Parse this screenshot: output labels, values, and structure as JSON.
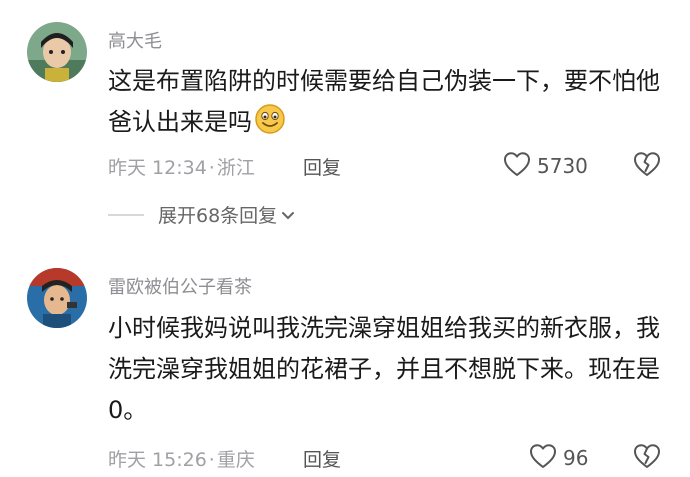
{
  "comments": [
    {
      "username": "高大毛",
      "text": "这是布置陷阱的时候需要给自己伪装一下，要不怕他爸认出来是吗",
      "emoji_icon": "grinning-face-emoji",
      "time": "昨天 12:34",
      "separator": "·",
      "location": "浙江",
      "reply_label": "回复",
      "like_count": "5730",
      "expand_label": "展开68条回复"
    },
    {
      "username": "雷欧被伯公子看茶",
      "text": "小时候我妈说叫我洗完澡穿姐姐给我买的新衣服，我洗完澡穿我姐姐的花裙子，并且不想脱下来。现在是0。",
      "time": "昨天 15:26",
      "separator": "·",
      "location": "重庆",
      "reply_label": "回复",
      "like_count": "96"
    }
  ],
  "icons": {
    "like": "heart-outline-icon",
    "dislike": "broken-heart-icon",
    "expand": "chevron-down-icon"
  },
  "colors": {
    "username": "#8e8e93",
    "text": "#1a1a1a",
    "meta": "#a0a0a5"
  }
}
